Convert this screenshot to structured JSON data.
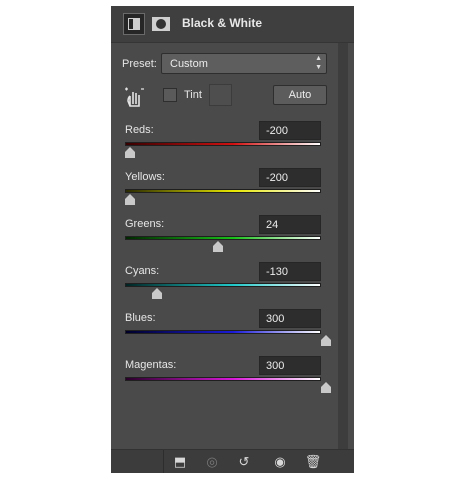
{
  "panel": {
    "title": "Black & White",
    "header_icons": [
      "adjustment-layer-icon",
      "layer-mask-icon"
    ]
  },
  "preset": {
    "label": "Preset:",
    "value": "Custom"
  },
  "tint": {
    "label": "Tint",
    "checked": false
  },
  "auto_label": "Auto",
  "sliders": [
    {
      "label": "Reds:",
      "value": "-200",
      "min": -200,
      "max": 300,
      "gradient": [
        "#3a0000",
        "#d21010",
        "#ffffff"
      ]
    },
    {
      "label": "Yellows:",
      "value": "-200",
      "min": -200,
      "max": 300,
      "gradient": [
        "#2a2a00",
        "#e6e600",
        "#ffffff"
      ]
    },
    {
      "label": "Greens:",
      "value": "24",
      "min": -200,
      "max": 300,
      "gradient": [
        "#002800",
        "#18c018",
        "#ffffff"
      ]
    },
    {
      "label": "Cyans:",
      "value": "-130",
      "min": -200,
      "max": 300,
      "gradient": [
        "#002424",
        "#20c8c8",
        "#ffffff"
      ]
    },
    {
      "label": "Blues:",
      "value": "300",
      "min": -200,
      "max": 300,
      "gradient": [
        "#00002a",
        "#1a1ad8",
        "#ffffff"
      ]
    },
    {
      "label": "Magentas:",
      "value": "300",
      "min": -200,
      "max": 300,
      "gradient": [
        "#2a002a",
        "#d818d8",
        "#ffffff"
      ]
    }
  ],
  "footer_icons": [
    "clip-to-layer-icon",
    "view-previous-state-icon",
    "reset-icon",
    "visibility-eye-icon",
    "trash-icon"
  ]
}
